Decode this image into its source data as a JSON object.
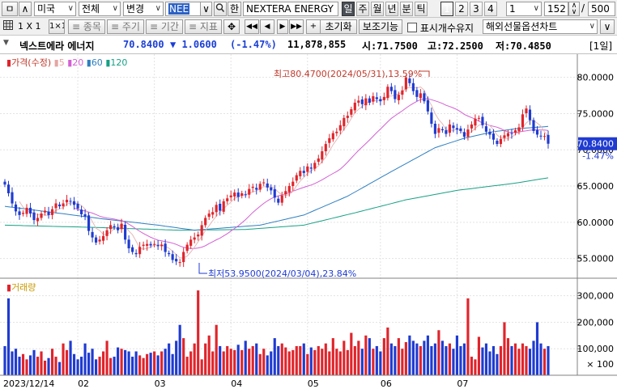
{
  "toolbar": {
    "nav_label": "ㅁ",
    "market": "미국",
    "market_scope": "전체",
    "change_label": "변경",
    "symbol": "NEE",
    "han_label": "한",
    "company": "NEXTERA ENERGY",
    "periods": [
      "일",
      "주",
      "월",
      "년",
      "분",
      "틱"
    ],
    "selected_period": "일",
    "layouts": [
      "1",
      "2",
      "3",
      "4"
    ],
    "selected_layout": "1",
    "unit_value": "1",
    "count_value": "152",
    "count_sep": "/",
    "count_total": "500"
  },
  "toolbar2": {
    "grid_label": "1 X 1",
    "one_label": "1×1",
    "item_label": "종목",
    "cycle_label": "주기",
    "period_label": "기간",
    "indicator_label": "지표",
    "reset_label": "초기화",
    "aux_label": "보조기능",
    "fix_label": "표시개수유지",
    "futures_label": "해외선물옵션차트"
  },
  "quote": {
    "name": "넥스트에라 에너지",
    "price": "70.8400",
    "change": "▼ 1.0600",
    "change_pct": "(-1.47%)",
    "volume": "11,878,855",
    "open": "시:71.7500",
    "high": "고:72.2500",
    "low": "저:70.4850",
    "period_tag": "[1일]"
  },
  "chart_data": {
    "type": "candlestick",
    "price_legend": {
      "label": "가격(수정)",
      "ma_periods": [
        "5",
        "20",
        "60",
        "120"
      ]
    },
    "volume_legend": "거래량",
    "price_axis_ticks": [
      "80.0000",
      "75.0000",
      "70.0000",
      "65.0000",
      "60.0000",
      "55.0000"
    ],
    "price_range": [
      52.5,
      83.2
    ],
    "volume_axis_ticks": [
      "300,000",
      "200,000",
      "100,000"
    ],
    "volume_unit": "× 100",
    "volume_range": [
      0,
      360000
    ],
    "x_ticks": [
      "2023/12/14",
      "02",
      "03",
      "04",
      "05",
      "06",
      "07"
    ],
    "current_price_label": "70.8400",
    "current_change_label": "-1.47%",
    "annotations": {
      "high": "최고80.4700(2024/05/31),13.59%",
      "low": "최저53.9500(2024/03/04),23.84%"
    },
    "closes": [
      65.2,
      64.0,
      62.6,
      61.5,
      61.0,
      61.3,
      62.0,
      61.2,
      60.3,
      60.6,
      61.2,
      61.6,
      61.0,
      61.8,
      62.6,
      62.2,
      62.6,
      63.1,
      62.9,
      62.4,
      61.9,
      61.1,
      60.8,
      58.8,
      57.9,
      57.2,
      57.6,
      58.1,
      58.9,
      59.6,
      59.3,
      58.9,
      59.8,
      57.6,
      56.4,
      55.9,
      55.6,
      56.6,
      56.9,
      57.0,
      56.8,
      57.0,
      56.7,
      56.9,
      55.9,
      55.6,
      54.8,
      54.6,
      54.5,
      55.9,
      56.9,
      57.6,
      57.9,
      58.3,
      59.6,
      60.6,
      61.2,
      61.4,
      62.4,
      61.6,
      62.9,
      63.3,
      63.7,
      64.1,
      63.5,
      64.0,
      63.8,
      64.6,
      64.9,
      64.5,
      65.3,
      65.5,
      64.8,
      64.4,
      63.4,
      62.7,
      63.7,
      64.3,
      65.0,
      65.6,
      66.5,
      67.1,
      66.8,
      67.7,
      67.4,
      68.2,
      68.8,
      69.8,
      70.8,
      71.6,
      72.3,
      72.5,
      73.4,
      74.4,
      74.7,
      75.6,
      76.5,
      76.8,
      76.3,
      77.1,
      76.5,
      77.4,
      77.0,
      76.7,
      77.3,
      78.7,
      78.1,
      77.0,
      77.6,
      78.2,
      80.0,
      79.2,
      78.1,
      77.3,
      77.8,
      76.7,
      75.3,
      73.6,
      72.2,
      73.0,
      72.7,
      72.2,
      73.5,
      73.0,
      72.8,
      72.6,
      71.8,
      72.8,
      73.5,
      74.3,
      74.4,
      73.4,
      72.5,
      72.1,
      71.4,
      70.8,
      71.5,
      72.0,
      72.3,
      72.2,
      72.7,
      73.1,
      74.9,
      75.7,
      74.1,
      72.6,
      72.1,
      71.9,
      71.9,
      70.84
    ],
    "ma5": [
      null,
      null,
      null,
      null,
      62.86,
      62.08,
      61.68,
      61.4,
      61.16,
      61.08,
      61.06,
      60.98,
      60.94,
      61.24,
      61.64,
      61.84,
      62.04,
      62.5,
      62.68,
      62.64,
      62.58,
      62.3,
      61.82,
      61.0,
      60.1,
      59.16,
      58.86,
      58.32,
      58.34,
      58.68,
      59.1,
      59.32,
      59.7,
      59.44,
      58.8,
      58.28,
      57.38,
      56.42,
      56.28,
      56.4,
      56.58,
      56.86,
      56.88,
      56.88,
      56.66,
      56.42,
      55.98,
      55.56,
      55.08,
      55.08,
      55.34,
      55.9,
      56.56,
      57.32,
      58.06,
      58.86,
      59.52,
      60.22,
      60.84,
      61.44,
      61.9,
      62.36,
      62.78,
      63.32,
      63.5,
      63.72,
      63.82,
      64.0,
      64.18,
      64.36,
      64.62,
      64.92,
      64.88,
      64.88,
      64.68,
      64.14,
      63.8,
      63.7,
      63.82,
      64.26,
      65.02,
      65.7,
      66.2,
      66.74,
      67.1,
      67.44,
      67.78,
      68.38,
      68.98,
      69.84,
      70.7,
      71.4,
      72.12,
      72.84,
      73.46,
      74.32,
      75.12,
      75.6,
      75.98,
      76.46,
      76.64,
      76.82,
      76.74,
      76.86,
      76.98,
      77.42,
      77.42,
      77.56,
      77.74,
      77.92,
      78.58,
      78.6,
      78.58,
      78.56,
      78.68,
      78.22,
      77.04,
      76.14,
      75.0,
      74.16,
      73.6,
      72.72,
      72.72,
      72.68,
      72.84,
      72.62,
      72.18,
      72.2,
      72.5,
      72.96,
      73.4,
      73.58,
      73.62,
      73.34,
      72.78,
      72.04,
      71.66,
      71.56,
      71.6,
      71.74,
      72.14,
      72.46,
      73.04,
      73.72,
      74.08,
      74.06,
      73.68,
      73.28,
      72.48,
      71.87
    ],
    "ma20": [
      null,
      null,
      null,
      null,
      null,
      null,
      null,
      null,
      null,
      null,
      null,
      null,
      null,
      null,
      null,
      null,
      null,
      null,
      null,
      61.94,
      61.78,
      61.64,
      61.55,
      61.41,
      61.26,
      61.06,
      60.84,
      60.69,
      60.58,
      60.53,
      60.44,
      60.31,
      60.25,
      60.04,
      59.73,
      59.43,
      59.08,
      58.75,
      58.45,
      58.18,
      57.93,
      57.73,
      57.52,
      57.43,
      57.33,
      57.25,
      57.11,
      56.94,
      56.72,
      56.54,
      56.43,
      56.37,
      56.38,
      56.45,
      56.56,
      56.77,
      57.05,
      57.31,
      57.58,
      57.81,
      58.11,
      58.43,
      58.78,
      59.14,
      59.5,
      59.92,
      60.36,
      60.85,
      61.35,
      61.78,
      62.2,
      62.6,
      62.95,
      63.25,
      63.49,
      63.65,
      63.78,
      63.94,
      64.07,
      64.29,
      64.47,
      64.66,
      64.82,
      64.99,
      65.14,
      65.35,
      65.6,
      65.86,
      66.15,
      66.45,
      66.73,
      67.0,
      67.34,
      67.79,
      68.3,
      68.85,
      69.39,
      69.91,
      70.38,
      70.86,
      71.36,
      71.87,
      72.38,
      72.86,
      73.36,
      73.88,
      74.35,
      74.71,
      75.06,
      75.38,
      75.77,
      76.11,
      76.41,
      76.69,
      76.93,
      77.04,
      77.05,
      76.92,
      76.76,
      76.59,
      76.4,
      76.14,
      75.98,
      75.78,
      75.56,
      75.25,
      74.89,
      74.66,
      74.45,
      74.25,
      73.96,
      73.7,
      73.52,
      73.37,
      73.24,
      73.12,
      72.92,
      72.66,
      72.45,
      72.41,
      72.41,
      72.46,
      72.55,
      72.62,
      72.71,
      72.75,
      72.75,
      72.73,
      72.73,
      72.66
    ],
    "ma60_anchors": [
      [
        0,
        62.2
      ],
      [
        14,
        61.3
      ],
      [
        28,
        60.4
      ],
      [
        42,
        59.6
      ],
      [
        52,
        58.9
      ],
      [
        70,
        59.6
      ],
      [
        82,
        61.0
      ],
      [
        94,
        63.6
      ],
      [
        106,
        67.0
      ],
      [
        118,
        70.3
      ],
      [
        126,
        71.6
      ],
      [
        134,
        72.5
      ],
      [
        140,
        72.9
      ],
      [
        151,
        73.3
      ]
    ],
    "ma120_anchors": [
      [
        0,
        59.6
      ],
      [
        24,
        59.3
      ],
      [
        48,
        58.9
      ],
      [
        66,
        59.0
      ],
      [
        82,
        59.6
      ],
      [
        96,
        61.3
      ],
      [
        110,
        63.1
      ],
      [
        124,
        64.4
      ],
      [
        140,
        65.4
      ],
      [
        151,
        66.3
      ]
    ],
    "volumes": [
      110,
      290,
      90,
      100,
      70,
      80,
      60,
      75,
      95,
      70,
      90,
      55,
      65,
      100,
      70,
      50,
      120,
      95,
      130,
      80,
      60,
      70,
      120,
      85,
      100,
      60,
      70,
      90,
      130,
      65,
      70,
      105,
      100,
      95,
      90,
      70,
      90,
      75,
      65,
      80,
      85,
      90,
      75,
      90,
      100,
      120,
      80,
      130,
      190,
      140,
      70,
      90,
      120,
      320,
      60,
      120,
      150,
      90,
      190,
      110,
      90,
      110,
      100,
      95,
      115,
      95,
      130,
      100,
      110,
      120,
      80,
      100,
      75,
      90,
      140,
      110,
      120,
      105,
      90,
      95,
      110,
      110,
      120,
      80,
      105,
      95,
      110,
      100,
      120,
      90,
      140,
      100,
      90,
      130,
      95,
      160,
      110,
      130,
      100,
      150,
      140,
      100,
      110,
      90,
      140,
      180,
      120,
      110,
      140,
      100,
      125,
      150,
      130,
      120,
      110,
      130,
      150,
      110,
      120,
      170,
      130,
      110,
      120,
      100,
      150,
      110,
      120,
      290,
      70,
      60,
      145,
      105,
      120,
      90,
      110,
      80,
      110,
      200,
      140,
      110,
      120,
      100,
      120,
      110,
      100,
      130,
      200,
      120,
      100,
      110,
      190,
      110,
      100,
      120
    ]
  }
}
